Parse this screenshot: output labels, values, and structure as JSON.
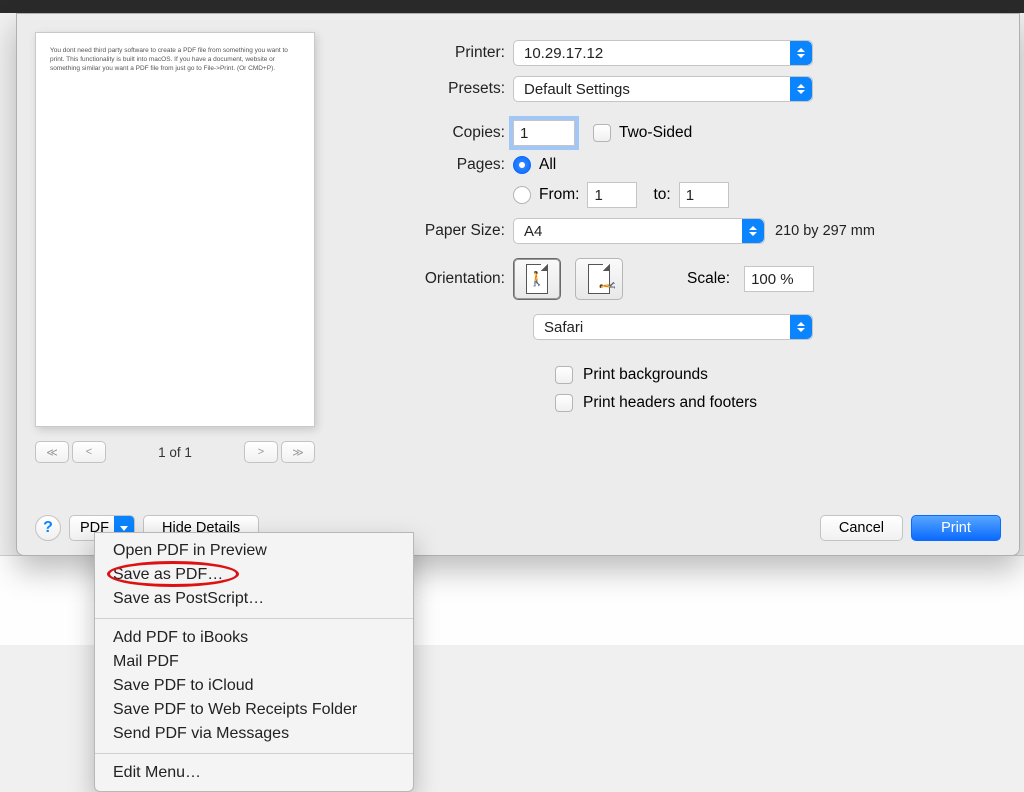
{
  "preview": {
    "text": "You dont need third party software to create a PDF file from something you want to print. This functionality is built into macOS. If you have a document, website or something similar you want a PDF file from just go to File->Print. (Or CMD+P).",
    "page_counter": "1 of 1"
  },
  "printer": {
    "label": "Printer:",
    "value": "10.29.17.12"
  },
  "presets": {
    "label": "Presets:",
    "value": "Default Settings"
  },
  "copies": {
    "label": "Copies:",
    "value": "1",
    "two_sided_label": "Two-Sided"
  },
  "pages": {
    "label": "Pages:",
    "all_label": "All",
    "from_label": "From:",
    "from_value": "1",
    "to_label": "to:",
    "to_value": "1"
  },
  "paper": {
    "label": "Paper Size:",
    "value": "A4",
    "note": "210 by 297 mm"
  },
  "orientation": {
    "label": "Orientation:",
    "scale_label": "Scale:",
    "scale_value": "100 %"
  },
  "app_select": {
    "value": "Safari"
  },
  "options": {
    "print_bg": "Print backgrounds",
    "print_headers": "Print headers and footers"
  },
  "footer": {
    "pdf_label": "PDF",
    "hide_details": "Hide Details",
    "cancel": "Cancel",
    "print": "Print"
  },
  "menu": {
    "items": [
      "Open PDF in Preview",
      "Save as PDF…",
      "Save as PostScript…",
      "Add PDF to iBooks",
      "Mail PDF",
      "Save PDF to iCloud",
      "Save PDF to Web Receipts Folder",
      "Send PDF via Messages",
      "Edit Menu…"
    ]
  }
}
